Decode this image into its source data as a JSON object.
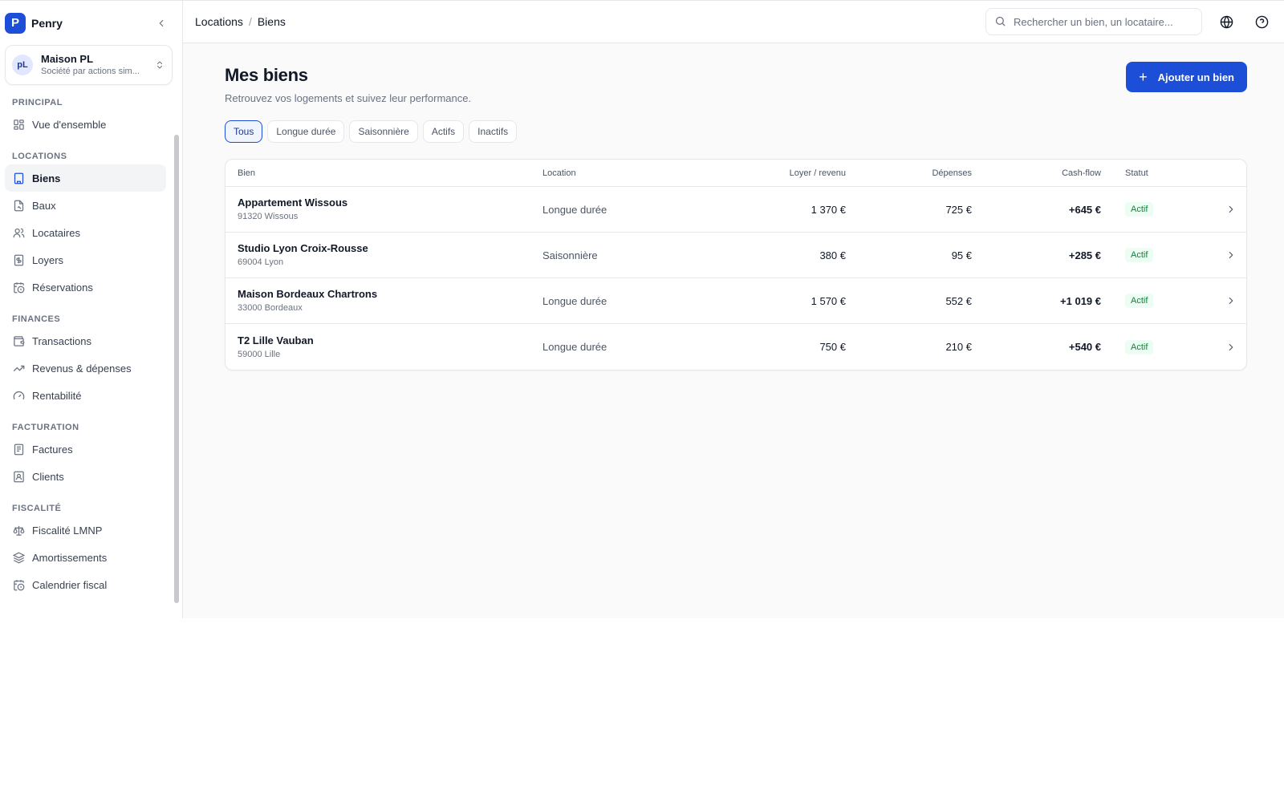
{
  "app": {
    "brand_initial": "P",
    "brand_name": "Penry"
  },
  "org": {
    "initials": "pL",
    "name": "Maison PL",
    "type": "Société par actions sim..."
  },
  "sidebar": {
    "sections": [
      {
        "label": "PRINCIPAL",
        "items": [
          {
            "label": "Vue d'ensemble",
            "icon": "dashboard-icon"
          }
        ]
      },
      {
        "label": "LOCATIONS",
        "items": [
          {
            "label": "Biens",
            "icon": "building-icon"
          },
          {
            "label": "Baux",
            "icon": "contract-icon"
          },
          {
            "label": "Locataires",
            "icon": "users-icon"
          },
          {
            "label": "Loyers",
            "icon": "receipt-icon"
          },
          {
            "label": "Réservations",
            "icon": "calendar-clock-icon"
          }
        ]
      },
      {
        "label": "FINANCES",
        "items": [
          {
            "label": "Transactions",
            "icon": "wallet-icon"
          },
          {
            "label": "Revenus & dépenses",
            "icon": "trending-up-icon"
          },
          {
            "label": "Rentabilité",
            "icon": "gauge-icon"
          }
        ]
      },
      {
        "label": "FACTURATION",
        "items": [
          {
            "label": "Factures",
            "icon": "invoice-icon"
          },
          {
            "label": "Clients",
            "icon": "contact-icon"
          }
        ]
      },
      {
        "label": "FISCALITÉ",
        "items": [
          {
            "label": "Fiscalité LMNP",
            "icon": "scale-icon"
          },
          {
            "label": "Amortissements",
            "icon": "layers-icon"
          },
          {
            "label": "Calendrier fiscal",
            "icon": "calendar-clock-icon"
          }
        ]
      }
    ],
    "active": "Biens"
  },
  "header": {
    "breadcrumb": [
      "Locations",
      "Biens"
    ],
    "search_placeholder": "Rechercher un bien, un locataire..."
  },
  "page": {
    "title": "Mes biens",
    "subtitle": "Retrouvez vos logements et suivez leur performance.",
    "add_button": "Ajouter un bien",
    "filters": [
      "Tous",
      "Longue durée",
      "Saisonnière",
      "Actifs",
      "Inactifs"
    ],
    "active_filter": "Tous"
  },
  "table": {
    "columns": [
      "Bien",
      "Location",
      "Loyer / revenu",
      "Dépenses",
      "Cash-flow",
      "Statut"
    ],
    "rows": [
      {
        "name": "Appartement Wissous",
        "address": "91320 Wissous",
        "location": "Longue durée",
        "loyer": "1 370 €",
        "depenses": "725 €",
        "cashflow": "+645 €",
        "statut": "Actif"
      },
      {
        "name": "Studio Lyon Croix-Rousse",
        "address": "69004 Lyon",
        "location": "Saisonnière",
        "loyer": "380 €",
        "depenses": "95 €",
        "cashflow": "+285 €",
        "statut": "Actif"
      },
      {
        "name": "Maison Bordeaux Chartrons",
        "address": "33000 Bordeaux",
        "location": "Longue durée",
        "loyer": "1 570 €",
        "depenses": "552 €",
        "cashflow": "+1 019 €",
        "statut": "Actif"
      },
      {
        "name": "T2 Lille Vauban",
        "address": "59000 Lille",
        "location": "Longue durée",
        "loyer": "750 €",
        "depenses": "210 €",
        "cashflow": "+540 €",
        "statut": "Actif"
      }
    ]
  },
  "colors": {
    "accent": "#1d4ed8",
    "status_active": "#15803d"
  }
}
